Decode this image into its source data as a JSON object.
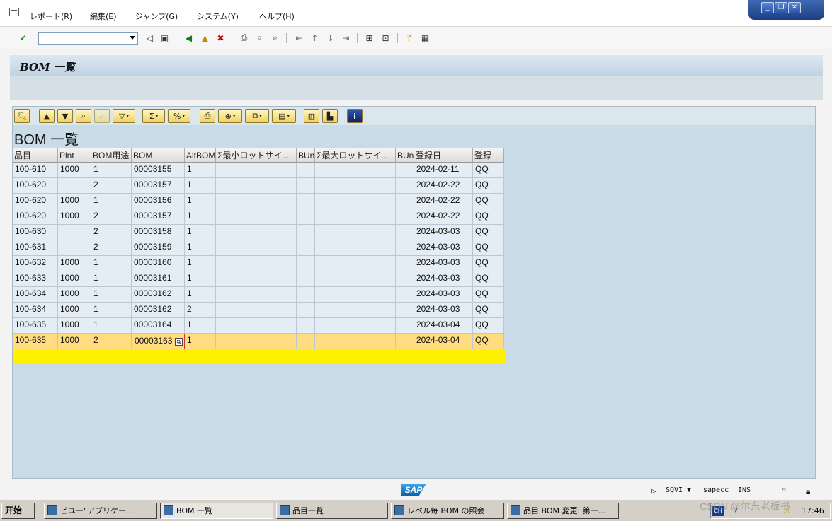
{
  "menu": {
    "items": [
      "レポート(R)",
      "編集(E)",
      "ジャンプ(G)",
      "システム(Y)",
      "ヘルプ(H)"
    ]
  },
  "window_controls": [
    "minimize-icon",
    "restore-icon",
    "close-icon"
  ],
  "toolbar": {
    "command_field_value": "",
    "icons": [
      "enter-icon",
      "back-arrow-icon",
      "save-icon",
      "back-icon",
      "exit-icon",
      "cancel-icon",
      "print-icon",
      "find-icon",
      "find-next-icon",
      "first-page-icon",
      "previous-page-icon",
      "next-page-icon",
      "last-page-icon",
      "create-session-icon",
      "shortcut-icon",
      "help-icon",
      "layout-icon"
    ]
  },
  "title": "BOM 一覧",
  "alv_toolbar": {
    "buttons": [
      "details-icon",
      "sort-ascending-icon",
      "sort-descending-icon",
      "find-icon",
      "find-next-icon",
      "filter-icon",
      "sum-icon",
      "subtotal-icon",
      "print-preview-icon",
      "export-icon",
      "local-file-icon",
      "views-icon",
      "layout-icon",
      "graphic-icon",
      "info-icon"
    ]
  },
  "list_title": "BOM 一覧",
  "grid": {
    "columns": [
      "品目",
      "Plnt",
      "BOM用途",
      "BOM",
      "AltBOM",
      "Σ最小ロットサイ...",
      "BUn",
      "Σ最大ロットサイ...",
      "BUn",
      "登録日",
      "登録"
    ],
    "rows": [
      [
        "100-610",
        "1000",
        "1",
        "00003155",
        "1",
        "",
        "",
        "",
        "",
        "2024-02-11",
        "QQ"
      ],
      [
        "100-620",
        "",
        "2",
        "00003157",
        "1",
        "",
        "",
        "",
        "",
        "2024-02-22",
        "QQ"
      ],
      [
        "100-620",
        "1000",
        "1",
        "00003156",
        "1",
        "",
        "",
        "",
        "",
        "2024-02-22",
        "QQ"
      ],
      [
        "100-620",
        "1000",
        "2",
        "00003157",
        "1",
        "",
        "",
        "",
        "",
        "2024-02-22",
        "QQ"
      ],
      [
        "100-630",
        "",
        "2",
        "00003158",
        "1",
        "",
        "",
        "",
        "",
        "2024-03-03",
        "QQ"
      ],
      [
        "100-631",
        "",
        "2",
        "00003159",
        "1",
        "",
        "",
        "",
        "",
        "2024-03-03",
        "QQ"
      ],
      [
        "100-632",
        "1000",
        "1",
        "00003160",
        "1",
        "",
        "",
        "",
        "",
        "2024-03-03",
        "QQ"
      ],
      [
        "100-633",
        "1000",
        "1",
        "00003161",
        "1",
        "",
        "",
        "",
        "",
        "2024-03-03",
        "QQ"
      ],
      [
        "100-634",
        "1000",
        "1",
        "00003162",
        "1",
        "",
        "",
        "",
        "",
        "2024-03-03",
        "QQ"
      ],
      [
        "100-634",
        "1000",
        "1",
        "00003162",
        "2",
        "",
        "",
        "",
        "",
        "2024-03-03",
        "QQ"
      ],
      [
        "100-635",
        "1000",
        "1",
        "00003164",
        "1",
        "",
        "",
        "",
        "",
        "2024-03-04",
        "QQ"
      ],
      [
        "100-635",
        "1000",
        "2",
        "00003163",
        "1",
        "",
        "",
        "",
        "",
        "2024-03-04",
        "QQ"
      ]
    ],
    "selected_row": 11,
    "focused_cell": "00003163"
  },
  "status": {
    "transaction": "SQVI",
    "system": "sapecc",
    "mode": "INS"
  },
  "taskbar": {
    "start": "开始",
    "tasks": [
      "ビユー\"アプリケー...",
      "BOM 一覧",
      "品目一覧",
      "レベル毎 BOM の照会",
      "品目 BOM 変更: 第一..."
    ],
    "active_task": 1,
    "clock": "17:46"
  },
  "watermark": "CSDN @尔东老板书"
}
